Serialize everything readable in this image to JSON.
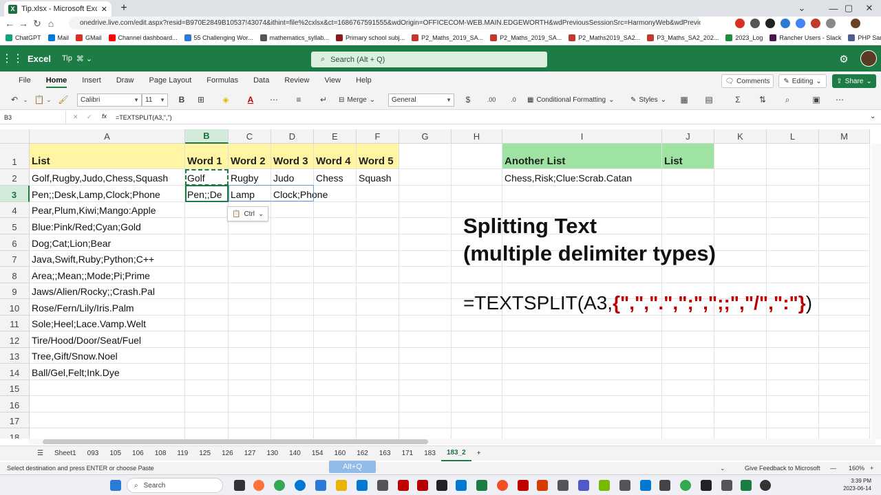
{
  "browser": {
    "tab_title": "Tip.xlsx - Microsoft Excel Online",
    "new_tab": "+",
    "url": "onedrive.live.com/edit.aspx?resid=B970E2849B10537!43074&ithint=file%2cxlsx&ct=1686767591555&wdOrigin=OFFICECOM-WEB.MAIN.EDGEWORTH&wdPreviousSessionSrc=HarmonyWeb&wdPreviousSession...",
    "bookmarks": [
      {
        "label": "ChatGPT",
        "color": "#10a37f"
      },
      {
        "label": "Mail",
        "color": "#0078d4"
      },
      {
        "label": "GMail",
        "color": "#d93025"
      },
      {
        "label": "Channel dashboard...",
        "color": "#ff0000"
      },
      {
        "label": "55 Challenging Wor...",
        "color": "#2b7bd6"
      },
      {
        "label": "mathematics_syllab...",
        "color": "#555555"
      },
      {
        "label": "Primary school subj...",
        "color": "#8b1a1a"
      },
      {
        "label": "P2_Maths_2019_SA...",
        "color": "#c0392b"
      },
      {
        "label": "P2_Maths_2019_SA...",
        "color": "#c0392b"
      },
      {
        "label": "P2_Maths2019_SA2...",
        "color": "#c0392b"
      },
      {
        "label": "P3_Maths_SA2_202...",
        "color": "#c0392b"
      },
      {
        "label": "2023_Log",
        "color": "#1e8e3e"
      },
      {
        "label": "Rancher Users - Slack",
        "color": "#4a154b"
      },
      {
        "label": "PHP Sandbox - Exe...",
        "color": "#4f5b93"
      }
    ]
  },
  "excel": {
    "app_name": "Excel",
    "doc_name": "Tip",
    "search_placeholder": "Search (Alt + Q)",
    "ribbon_tabs": [
      "File",
      "Home",
      "Insert",
      "Draw",
      "Page Layout",
      "Formulas",
      "Data",
      "Review",
      "View",
      "Help"
    ],
    "comments_label": "Comments",
    "editing_label": "Editing",
    "share_label": "Share",
    "font_name": "Calibri",
    "font_size": "11",
    "merge_label": "Merge",
    "number_format": "General",
    "currency_symbol": "$",
    "cond_format_label": "Conditional Formatting",
    "styles_label": "Styles",
    "name_box": "B3",
    "formula": "=TEXTSPLIT(A3,\",\")",
    "fx_label": "fx"
  },
  "grid": {
    "columns": [
      "A",
      "B",
      "C",
      "D",
      "E",
      "F",
      "G",
      "H",
      "I",
      "J",
      "K",
      "L",
      "M"
    ],
    "rows": [
      "1",
      "2",
      "3",
      "4",
      "5",
      "6",
      "7",
      "8",
      "9",
      "10",
      "11",
      "12",
      "13",
      "14",
      "15",
      "16",
      "17",
      "18"
    ],
    "A": [
      "List",
      "Golf,Rugby,Judo,Chess,Squash",
      "Pen;;Desk,Lamp,Clock;Phone",
      "Pear,Plum,Kiwi;Mango:Apple",
      "Blue:Pink/Red;Cyan;Gold",
      "Dog;Cat;Lion;Bear",
      "Java,Swift,Ruby;Python;C++",
      "Area;;Mean;;Mode;Pi;Prime",
      "Jaws/Alien/Rocky;;Crash.Pal",
      "Rose/Fern/Lily/Iris.Palm",
      "Sole;Heel;Lace.Vamp.Welt",
      "Tire/Hood/Door/Seat/Fuel",
      "Tree,Gift/Snow.Noel",
      "    Ball/Gel,Felt;Ink.Dye"
    ],
    "header_words": [
      "Word 1",
      "Word 2",
      "Word 3",
      "Word 4",
      "Word 5"
    ],
    "row2_words": [
      "Golf",
      "Rugby",
      "Judo",
      "Chess",
      "Squash"
    ],
    "row3_words": [
      "Pen;;De",
      "Lamp",
      "Clock;Phone"
    ],
    "I1": "Another List",
    "J1": "List",
    "I2": "Chess,Risk;Clue:Scrab.Catan"
  },
  "overlay": {
    "ctrl_label": "Ctrl",
    "title_line1": "Splitting Text",
    "title_line2": "(multiple delimiter types)",
    "formula_prefix": "=TEXTSPLIT(A3,",
    "formula_array": "{\",\",\".\",\";\",\";;\",\"/\",\":\"}",
    "formula_suffix": ")"
  },
  "sheets": {
    "tabs": [
      "Sheet1",
      "093",
      "105",
      "106",
      "108",
      "119",
      "125",
      "126",
      "127",
      "130",
      "140",
      "154",
      "160",
      "162",
      "163",
      "171",
      "183",
      "183_2"
    ],
    "active": "183_2",
    "add": "+"
  },
  "status": {
    "message": "Select destination and press ENTER or choose Paste",
    "feedback": "Give Feedback to Microsoft",
    "zoom": "160%",
    "altq": "Alt+Q"
  },
  "taskbar": {
    "search": "Search",
    "time": "3:39 PM",
    "date": "2023-06-14"
  }
}
